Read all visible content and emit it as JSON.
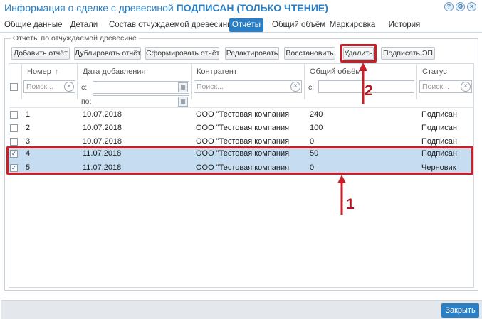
{
  "window": {
    "title_prefix": "Информация о сделке с древесиной",
    "title_status": "ПОДПИСАН (ТОЛЬКО ЧТЕНИЕ)",
    "icons": [
      "help-icon",
      "settings-icon",
      "close-icon"
    ]
  },
  "tabs": [
    {
      "label": "Общие данные"
    },
    {
      "label": "Детали"
    },
    {
      "label": "Состав отчуждаемой древесины"
    },
    {
      "label": "Отчёты"
    },
    {
      "label": "Общий объём"
    },
    {
      "label": "Маркировка"
    },
    {
      "label": "История"
    }
  ],
  "panel": {
    "legend": "Отчёты по отчуждаемой древесине"
  },
  "toolbar": [
    {
      "label": "Добавить отчёт"
    },
    {
      "label": "Дублировать отчёт"
    },
    {
      "label": "Сформировать отчёт"
    },
    {
      "label": "Редактировать"
    },
    {
      "label": "Восстановить"
    },
    {
      "label": "Удалить"
    },
    {
      "label": "Подписать ЭП"
    }
  ],
  "columns": [
    {
      "label": "Номер",
      "sort": "↑"
    },
    {
      "label": "Дата добавления"
    },
    {
      "label": "Контрагент"
    },
    {
      "label": "Общий объём, т"
    },
    {
      "label": "Статус"
    }
  ],
  "filters": {
    "number_placeholder": "Поиск...",
    "date_from_label": "с:",
    "date_to_label": "по:",
    "contractor_placeholder": "Поиск...",
    "volume_from_label": "с:",
    "status_placeholder": "Поиск..."
  },
  "rows": [
    {
      "number": "1",
      "date": "10.07.2018",
      "contractor": "ООО \"Тестовая компания",
      "volume": "240",
      "status": "Подписан",
      "checked": false
    },
    {
      "number": "2",
      "date": "10.07.2018",
      "contractor": "ООО \"Тестовая компания",
      "volume": "100",
      "status": "Подписан",
      "checked": false
    },
    {
      "number": "3",
      "date": "10.07.2018",
      "contractor": "ООО \"Тестовая компания",
      "volume": "0",
      "status": "Подписан",
      "checked": false
    },
    {
      "number": "4",
      "date": "11.07.2018",
      "contractor": "ООО \"Тестовая компания",
      "volume": "50",
      "status": "Подписан",
      "checked": true
    },
    {
      "number": "5",
      "date": "11.07.2018",
      "contractor": "ООО \"Тестовая компания",
      "volume": "0",
      "status": "Черновик",
      "checked": true
    }
  ],
  "annotations": {
    "label1": "1",
    "label2": "2",
    "color": "#c8202a"
  },
  "footer": {
    "close_label": "Закрыть"
  },
  "colors": {
    "accent": "#2a7fc4",
    "selected_row": "#c5dcf1"
  }
}
